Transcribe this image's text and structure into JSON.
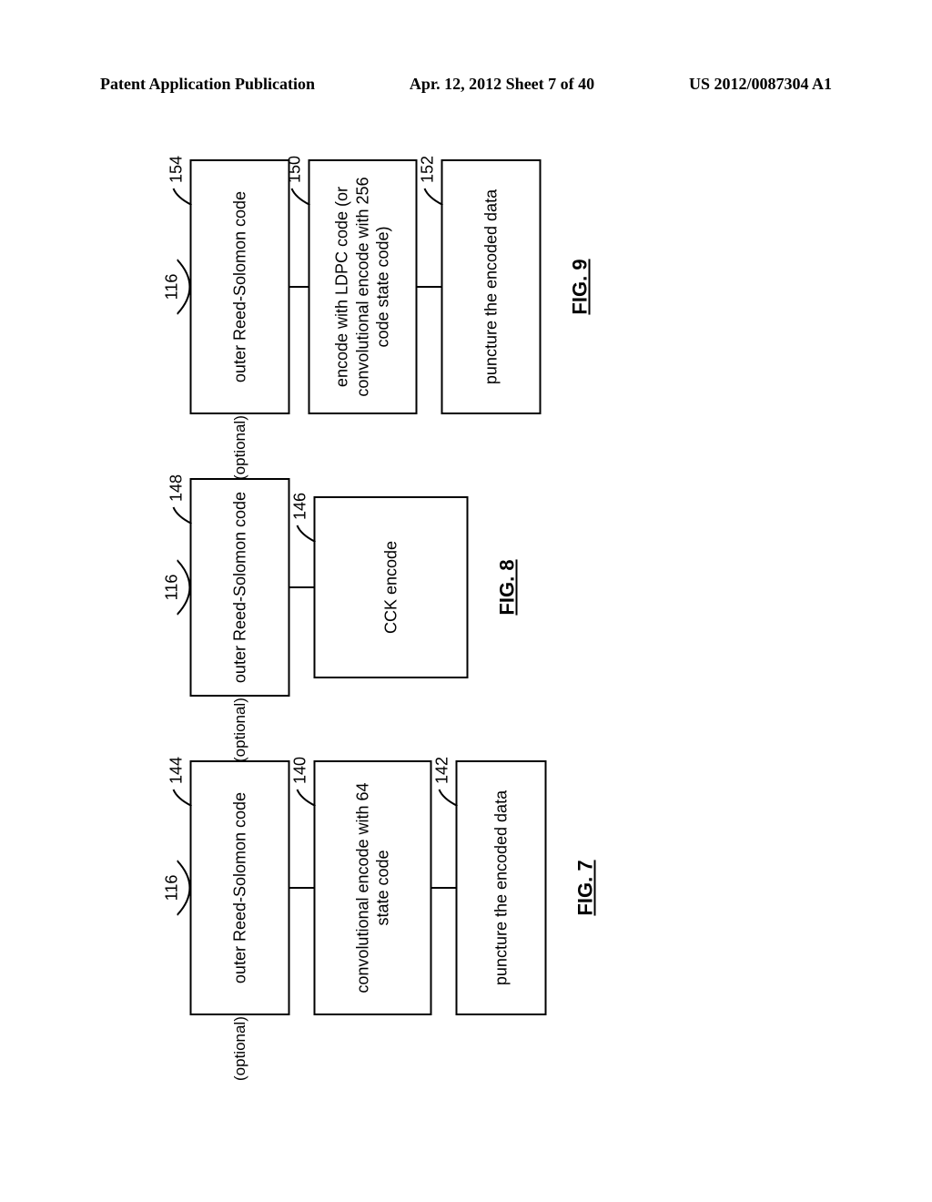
{
  "header": {
    "left": "Patent Application Publication",
    "center": "Apr. 12, 2012  Sheet 7 of 40",
    "right": "US 2012/0087304 A1"
  },
  "fig7": {
    "entry_ref": "116",
    "optional": "(optional)",
    "box_outer": "outer Reed-Solomon code",
    "ref_outer": "144",
    "box_conv": "convolutional encode with 64 state code",
    "ref_conv": "140",
    "box_punc": "puncture the encoded data",
    "ref_punc": "142",
    "caption": "FIG. 7"
  },
  "fig8": {
    "entry_ref": "116",
    "optional": "(optional)",
    "box_outer": "outer Reed-Solomon code",
    "ref_outer": "148",
    "box_cck": "CCK encode",
    "ref_cck": "146",
    "caption": "FIG. 8"
  },
  "fig9": {
    "entry_ref": "116",
    "optional": "(optional)",
    "box_outer": "outer Reed-Solomon code",
    "ref_outer": "154",
    "box_ldpc": "encode with LDPC code (or convolutional encode with 256 code state code)",
    "ref_ldpc": "150",
    "box_punc": "puncture the encoded data",
    "ref_punc": "152",
    "caption": "FIG. 9"
  }
}
